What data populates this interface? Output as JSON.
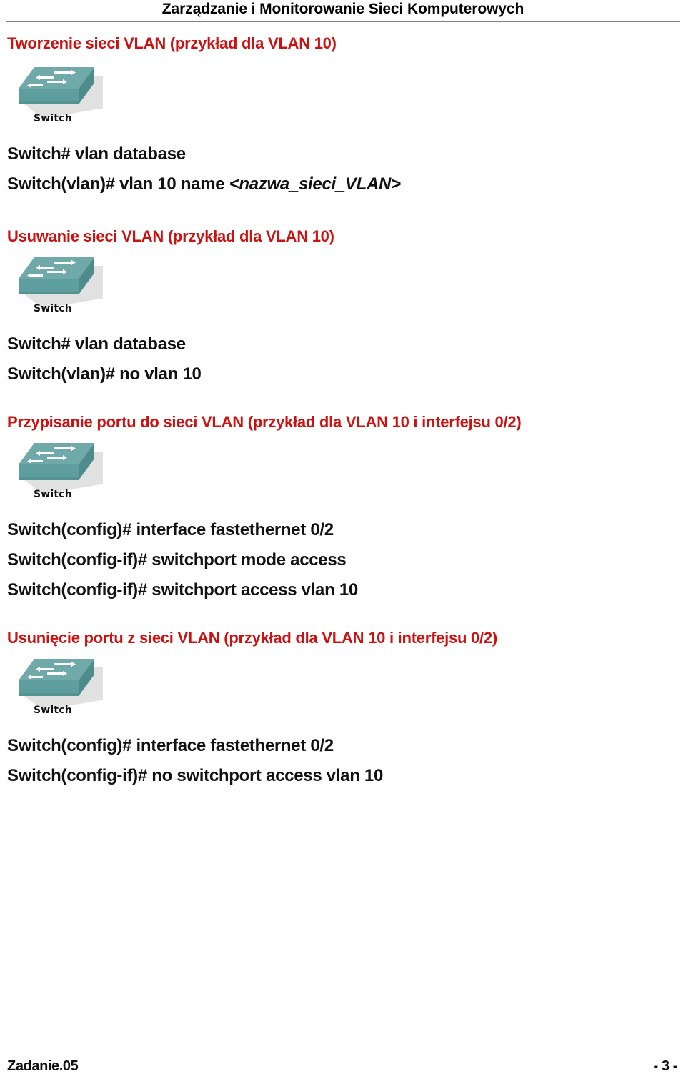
{
  "header": {
    "title": "Zarządzanie i Monitorowanie Sieci Komputerowych"
  },
  "icons": {
    "switch_caption": "Switch",
    "switch_icon_name": "network-switch-icon",
    "switch_body_color": "#5F9E9E",
    "switch_top_color": "#6FA9A9",
    "switch_side_color": "#4E8B8B",
    "switch_arrow_color": "#FFFFFF"
  },
  "colors": {
    "heading_red": "#CC1111",
    "body_black": "#111111",
    "rule_gray": "#808080"
  },
  "sections": [
    {
      "heading": "Tworzenie sieci VLAN (przykład dla VLAN 10)",
      "commands": [
        {
          "text": "Switch# vlan database",
          "placeholder": ""
        },
        {
          "text": "Switch(vlan)# vlan 10 name ",
          "placeholder": "<nazwa_sieci_VLAN>"
        }
      ]
    },
    {
      "heading": "Usuwanie sieci VLAN (przykład dla VLAN 10)",
      "commands": [
        {
          "text": "Switch# vlan database",
          "placeholder": ""
        },
        {
          "text": "Switch(vlan)# no vlan 10",
          "placeholder": ""
        }
      ]
    },
    {
      "heading": "Przypisanie portu do sieci VLAN (przykład dla VLAN 10 i interfejsu 0/2)",
      "commands": [
        {
          "text": "Switch(config)# interface fastethernet 0/2",
          "placeholder": ""
        },
        {
          "text": "Switch(config-if)# switchport mode access",
          "placeholder": ""
        },
        {
          "text": "Switch(config-if)# switchport access vlan 10",
          "placeholder": ""
        }
      ]
    },
    {
      "heading": "Usunięcie portu z sieci VLAN (przykład dla VLAN 10 i interfejsu 0/2)",
      "commands": [
        {
          "text": "Switch(config)# interface fastethernet 0/2",
          "placeholder": ""
        },
        {
          "text": "Switch(config-if)# no switchport access vlan 10",
          "placeholder": ""
        }
      ]
    }
  ],
  "footer": {
    "left": "Zadanie.05",
    "right": "- 3 -"
  }
}
